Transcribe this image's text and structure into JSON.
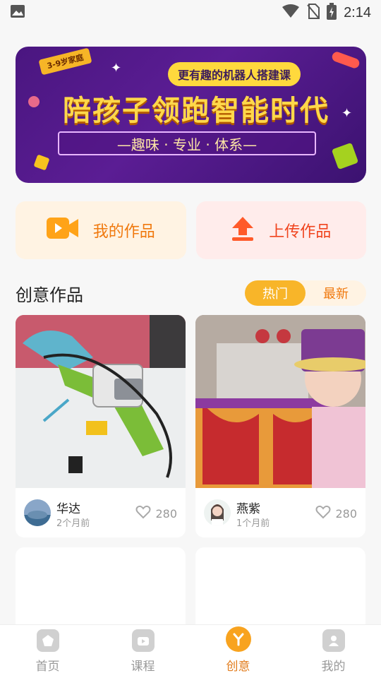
{
  "status": {
    "time": "2:14"
  },
  "banner": {
    "age_tag": "3-9岁家庭",
    "sub_tag": "更有趣的机器人搭建课",
    "headline": "陪孩子领跑智能时代",
    "tagline": "—趣味 · 专业 · 体系—"
  },
  "actions": {
    "my_works": "我的作品",
    "upload": "上传作品"
  },
  "section": {
    "title": "创意作品",
    "tabs": [
      "热门",
      "最新"
    ],
    "active_tab": "热门"
  },
  "works": [
    {
      "author": "华达",
      "time": "2个月前",
      "likes": "280"
    },
    {
      "author": "燕紫",
      "time": "1个月前",
      "likes": "280"
    }
  ],
  "tab_bar": {
    "items": [
      "首页",
      "课程",
      "创意",
      "我的"
    ],
    "active": "创意"
  },
  "colors": {
    "accent": "#f8b529",
    "orange_text": "#f0790e",
    "upload_red": "#f0441e"
  }
}
